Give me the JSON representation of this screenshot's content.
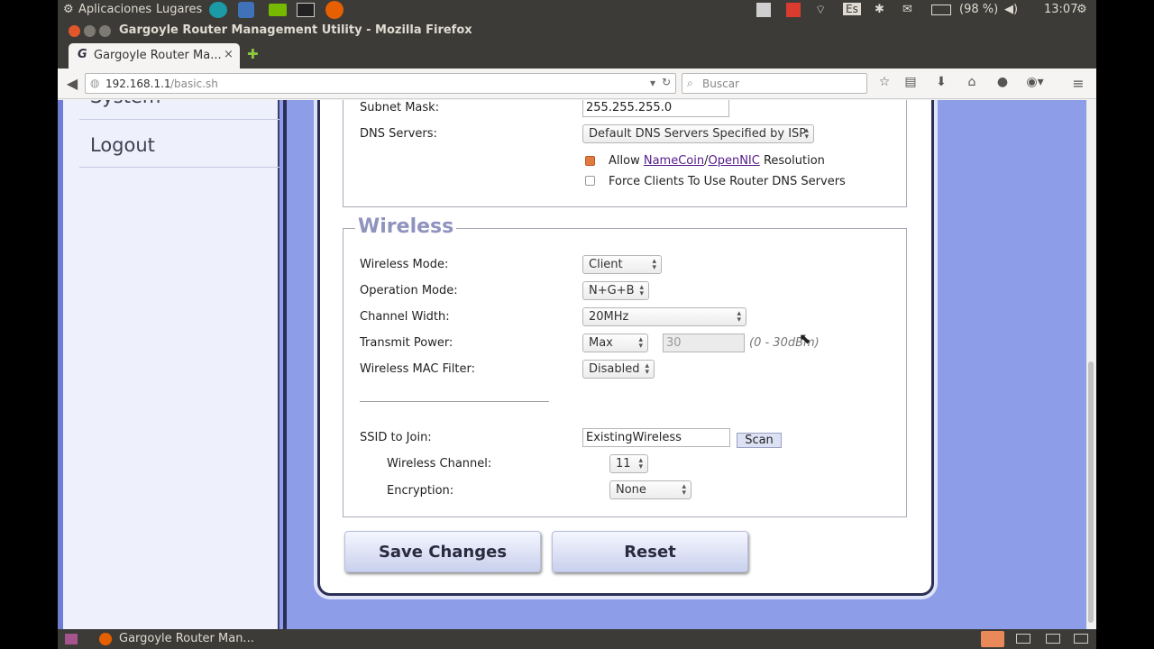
{
  "topbar": {
    "apps": "Aplicaciones",
    "places": "Lugares",
    "lang": "Es",
    "battery": "(98 %)",
    "time": "13:07"
  },
  "window": {
    "title": "Gargoyle Router Management Utility - Mozilla Firefox"
  },
  "tab": {
    "label": "Gargoyle Router Ma...",
    "close": "×",
    "new": "✚"
  },
  "nav": {
    "url_host": "192.168.1.1",
    "url_path": "/basic.sh",
    "search_placeholder": "Buscar"
  },
  "sidebar": {
    "items": [
      {
        "label": "System"
      },
      {
        "label": "Logout"
      }
    ]
  },
  "dns": {
    "subnet_label": "Subnet Mask:",
    "subnet_value": "255.255.255.0",
    "dns_label": "DNS Servers:",
    "dns_value": "Default DNS Servers Specified by ISP",
    "allow_pre": "Allow ",
    "namecoin": "NameCoin",
    "slash": "/",
    "opennic": "OpenNIC",
    "allow_post": " Resolution",
    "allow_checked": true,
    "force_label": "Force Clients To Use Router DNS Servers",
    "force_checked": false
  },
  "wireless": {
    "legend": "Wireless",
    "mode_label": "Wireless Mode:",
    "mode_value": "Client",
    "op_label": "Operation Mode:",
    "op_value": "N+G+B",
    "width_label": "Channel Width:",
    "width_value": "20MHz",
    "power_label": "Transmit Power:",
    "power_value": "Max",
    "power_input": "30",
    "power_range": "(0 - 30dBm)",
    "mac_label": "Wireless MAC Filter:",
    "mac_value": "Disabled",
    "ssid_label": "SSID to Join:",
    "ssid_value": "ExistingWireless",
    "scan": "Scan",
    "chan_label": "Wireless Channel:",
    "chan_value": "11",
    "enc_label": "Encryption:",
    "enc_value": "None"
  },
  "actions": {
    "save": "Save Changes",
    "reset": "Reset"
  },
  "taskbar": {
    "label": "Gargoyle Router Man..."
  }
}
